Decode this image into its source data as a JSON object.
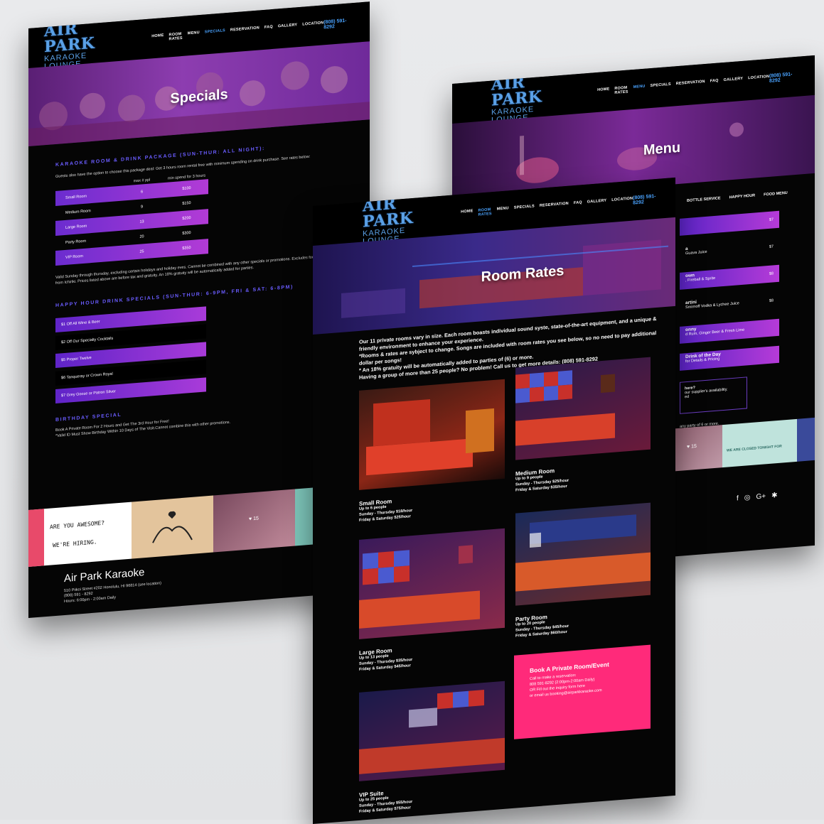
{
  "nav": {
    "logo_line1": "AIR PARK",
    "logo_line2": "KARAOKE LOUNGE",
    "links": [
      "HOME",
      "ROOM RATES",
      "MENU",
      "SPECIALS",
      "RESERVATION",
      "FAQ",
      "GALLERY",
      "LOCATION"
    ],
    "phone": "(808) 591-8292"
  },
  "specials": {
    "hero_title": "Specials",
    "package_title": "KARAOKE ROOM & DRINK PACKAGE (SUN-THUR: ALL NIGHT):",
    "package_desc": "Guests also have the option to choose this package deal: Get 3 hours room rental free with minimum spending on drink purchase. See rates below:",
    "table_headers": [
      "",
      "max # ppl",
      "min spend for 3 hours"
    ],
    "rows": [
      {
        "room": "Small Room",
        "max": "6",
        "min": "$100"
      },
      {
        "room": "Medium Room",
        "max": "9",
        "min": "$150"
      },
      {
        "room": "Large Room",
        "max": "13",
        "min": "$200"
      },
      {
        "room": "Party Room",
        "max": "20",
        "min": "$300"
      },
      {
        "room": "VIP Room",
        "max": "25",
        "min": "$350"
      }
    ],
    "terms": "Valid Sunday through thursday, excluding certain holidays and holiday eves. Cannot be combined with any other specials or promotions. Excludes food purchase from Ichiriki. Prices listed above are before tax and gratuity. An 18% gratuity will be automatically added for parties.",
    "happy_hour_title": "HAPPY HOUR DRINK SPECIALS (SUN-THUR: 6-9PM, FRI & SAT: 6-8PM)",
    "happy_hour_items": [
      "$1 Off All Wine & Beer",
      "$2 Off Our Specialty Cocktails",
      "$5 Proper Twelve",
      "$6 Tanqueray or Crown Royal",
      "$7 Grey Goose or Patron Silver"
    ],
    "birthday_title": "BIRTHDAY SPECIAL",
    "birthday_desc": "Book A Private Room For 2 Hours and Get The 3rd Hour for Free!",
    "birthday_note": "*Valid ID Must Show Birthday Within 10 Days of The Visit.Cannot combine this with other promotions.",
    "hiring_line1": "ARE YOU AWESOME?",
    "hiring_line2": "WE'RE HIRING.",
    "insta_count": "15",
    "footer_name": "Air Park Karaoke",
    "footer_address": "510 Piikoi Street #202 Honolulu, HI 96814 (see location)",
    "footer_phone": "(808) 591 - 8292",
    "footer_hours": "Hours: 6:00pm - 2:00am Daily"
  },
  "menu": {
    "hero_title": "Menu",
    "tabs": [
      "BOTTLE SERVICE",
      "HAPPY HOUR",
      "FOOD MENU"
    ],
    "items": [
      {
        "name": "",
        "desc": "",
        "price": "$7"
      },
      {
        "name": "a",
        "desc": "Guava Juice",
        "price": "$7"
      },
      {
        "name": "own",
        "desc": ", Fireball & Sprite",
        "price": "$8"
      },
      {
        "name": "artini",
        "desc": "Smirnoff Vodka & Lychee Juice",
        "price": "$8"
      },
      {
        "name": "onny",
        "desc": "d Rum, Ginger Beer & Fresh Lime",
        "price": ""
      },
      {
        "name": "Drink of the Day",
        "desc": "for Details & Pricing",
        "price": ""
      }
    ],
    "note_title": "here?",
    "note_line1": "our supplier's availability.",
    "note_line2": "ed",
    "gratuity": "any party of 6 or more.",
    "closed_banner": "WE ARE CLOSED TONIGHT FOR",
    "insta_count": "15"
  },
  "room_rates": {
    "hero_title": "Room Rates",
    "intro": "Our 11 private rooms vary in size. Each room boasts individual sound syste, state-of-the-art equipment, and a unique & friendly environment to enhance your experience.",
    "note1": "*Rooms & rates are sybject to change. Songs are included with room rates you see below, so no need to pay additional dollar per songs!",
    "note2": "* An 18% gratuity will be automatically added to parties of (6) or more.",
    "note3": "Having a group of more than 25 people? No problem! Call us to get more details: (808) 591-8292",
    "rooms": [
      {
        "name": "Small Room",
        "people": "Up to 6 people",
        "weekday": "Sunday - Thursday $18/hour",
        "weekend": "Friday & Saturday $25/hour"
      },
      {
        "name": "Medium Room",
        "people": "Up to 9 people",
        "weekday": "Sunday - Thursday $25/hour",
        "weekend": "Friday & Saturday $35/hour"
      },
      {
        "name": "Large Room",
        "people": "Up to 13 people",
        "weekday": "Sunday - Thursday $35/hour",
        "weekend": "Friday & Saturday $45/hour"
      },
      {
        "name": "Party Room",
        "people": "Up to 20 people",
        "weekday": "Sunday - Thursday $45/hour",
        "weekend": "Friday & Saturday $60/hour"
      },
      {
        "name": "VIP Suite",
        "people": "Up to 25 people",
        "weekday": "Sunday - Thursday $55/hour",
        "weekend": "Friday & Saturday $75/hour"
      }
    ],
    "book_title": "Book A Private Room/Event",
    "book_lines": [
      "Call to make a reservation:",
      "808 591-8292 (2:00pm-2:00am Daily)",
      "OR Fill out the inquiry form here",
      "or email us booking@airparkkaraoke.com"
    ]
  }
}
